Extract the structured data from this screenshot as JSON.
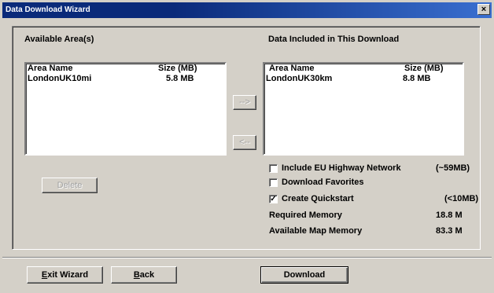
{
  "window": {
    "title": "Data Download Wizard",
    "close_glyph": "×"
  },
  "available": {
    "heading": "Available Area(s)",
    "col_name": "Area Name",
    "col_size": "Size (MB)",
    "rows": [
      {
        "name": "LondonUK10mi",
        "size": "5.8 MB"
      }
    ]
  },
  "included": {
    "heading": "Data Included in This Download",
    "col_name": "Area Name",
    "col_size": "Size (MB)",
    "rows": [
      {
        "name": "LondonUK30km",
        "size": "8.8 MB"
      }
    ]
  },
  "buttons": {
    "add": "-->",
    "remove": "<--",
    "delete": "Delete",
    "exit_first": "E",
    "exit_rest": "xit Wizard",
    "back_first": "B",
    "back_rest": "ack",
    "download": "Download"
  },
  "options": {
    "eu_highway": {
      "label": "Include EU Highway Network",
      "note": "(~59MB)",
      "checked": false
    },
    "favorites": {
      "label": "Download Favorites",
      "checked": false
    },
    "quickstart": {
      "label": "Create Quickstart",
      "note": "(<10MB)",
      "checked": true
    }
  },
  "memory": {
    "required_label": "Required Memory",
    "required_value": "18.8 M",
    "available_label": "Available Map Memory",
    "available_value": "83.3 M"
  }
}
